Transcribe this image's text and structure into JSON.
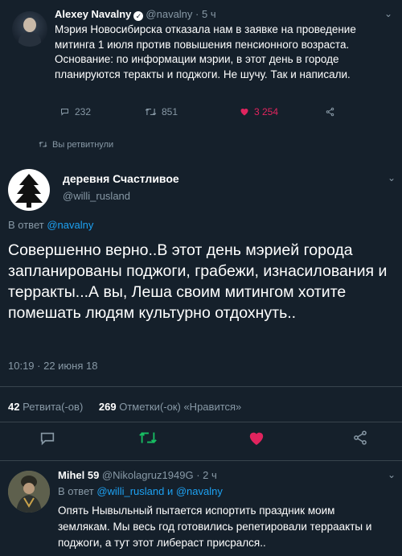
{
  "tweet1": {
    "name": "Alexey Navalny",
    "handle": "@navalny",
    "time": "5 ч",
    "text": "Мэрия Новосибирска отказала нам в заявке на проведение митинга 1 июля против повышения пенсионного возраста. Основание: по информации мэрии, в этот день в городе планируются теракты и поджоги. Не шучу. Так и написали.",
    "replies": "232",
    "retweets": "851",
    "likes": "3 254"
  },
  "retweeted_label": "Вы ретвитнули",
  "tweet2": {
    "name": "деревня Счастливое",
    "handle": "@willi_rusland",
    "reply_prefix": "В ответ",
    "reply_to": "@navalny",
    "text": "Совершенно верно..В этот день мэрией города запланированы поджоги, грабежи, изнасилования и терракты...А вы, Леша своим митингом хотите помешать людям культурно отдохнуть..",
    "timestamp": "10:19 · 22 июня 18",
    "retweet_count": "42",
    "retweet_label": "Ретвита(-ов)",
    "like_count": "269",
    "like_label": "Отметки(-ок) «Нравится»"
  },
  "tweet3": {
    "name": "Mihel 59",
    "handle": "@Nikolagruz1949G",
    "time": "2 ч",
    "reply_prefix": "В ответ",
    "reply_to_1": "@willi_rusland",
    "reply_and": "и",
    "reply_to_2": "@navalny",
    "text": "Опять Нывыльный пытается испортить праздник моим землякам. Мы весь год готовились репетировали терраакты и поджоги, а тут этот либераст присрался.."
  },
  "colors": {
    "background": "#15202b",
    "muted": "#8899a6",
    "link": "#1da1f2",
    "like": "#e0245e",
    "retweet": "#17bf63"
  }
}
